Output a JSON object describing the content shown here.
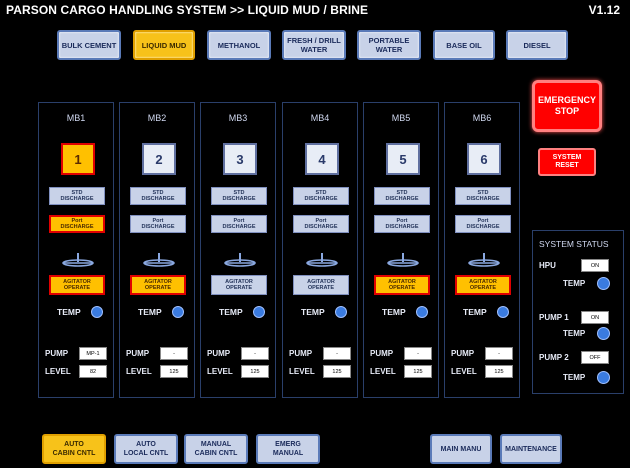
{
  "header": {
    "title": "PARSON CARGO HANDLING SYSTEM   >> LIQUID MUD / BRINE",
    "version": "V1.12"
  },
  "tabs": [
    {
      "label": "BULK CEMENT",
      "active": false
    },
    {
      "label": "LIQUID MUD",
      "active": true
    },
    {
      "label": "METHANOL",
      "active": false
    },
    {
      "label": "FRESH / DRILL\nWATER",
      "active": false
    },
    {
      "label": "PORTABLE\nWATER",
      "active": false
    },
    {
      "label": "BASE OIL",
      "active": false
    },
    {
      "label": "DIESEL",
      "active": false
    }
  ],
  "mixers": [
    {
      "name": "MB1",
      "number": "1",
      "selected": true,
      "std_discharge": "STD\nDISCHARGE",
      "std_active": false,
      "port_discharge": "Port\nDISCHARGE",
      "port_active": true,
      "agitator": "AGITATOR\nOPERATE",
      "agitator_active": true,
      "temp_label": "TEMP",
      "pump_label": "PUMP",
      "pump_value": "MP-1",
      "level_label": "LEVEL",
      "level_value": "82"
    },
    {
      "name": "MB2",
      "number": "2",
      "selected": false,
      "std_discharge": "STD\nDISCHARGE",
      "std_active": false,
      "port_discharge": "Port\nDISCHARGE",
      "port_active": false,
      "agitator": "AGITATOR\nOPERATE",
      "agitator_active": true,
      "temp_label": "TEMP",
      "pump_label": "PUMP",
      "pump_value": "-",
      "level_label": "LEVEL",
      "level_value": "125"
    },
    {
      "name": "MB3",
      "number": "3",
      "selected": false,
      "std_discharge": "STD\nDISCHARGE",
      "std_active": false,
      "port_discharge": "Port\nDISCHARGE",
      "port_active": false,
      "agitator": "AGITATOR\nOPERATE",
      "agitator_active": false,
      "temp_label": "TEMP",
      "pump_label": "PUMP",
      "pump_value": "-",
      "level_label": "LEVEL",
      "level_value": "125"
    },
    {
      "name": "MB4",
      "number": "4",
      "selected": false,
      "std_discharge": "STD\nDISCHARGE",
      "std_active": false,
      "port_discharge": "Port\nDISCHARGE",
      "port_active": false,
      "agitator": "AGITATOR\nOPERATE",
      "agitator_active": false,
      "temp_label": "TEMP",
      "pump_label": "PUMP",
      "pump_value": "-",
      "level_label": "LEVEL",
      "level_value": "125"
    },
    {
      "name": "MB5",
      "number": "5",
      "selected": false,
      "std_discharge": "STD\nDISCHARGE",
      "std_active": false,
      "port_discharge": "Port\nDISCHARGE",
      "port_active": false,
      "agitator": "AGITATOR\nOPERATE",
      "agitator_active": true,
      "temp_label": "TEMP",
      "pump_label": "PUMP",
      "pump_value": "-",
      "level_label": "LEVEL",
      "level_value": "125"
    },
    {
      "name": "MB6",
      "number": "6",
      "selected": false,
      "std_discharge": "STD\nDISCHARGE",
      "std_active": false,
      "port_discharge": "Port\nDISCHARGE",
      "port_active": false,
      "agitator": "AGITATOR\nOPERATE",
      "agitator_active": true,
      "temp_label": "TEMP",
      "pump_label": "PUMP",
      "pump_value": "-",
      "level_label": "LEVEL",
      "level_value": "125"
    }
  ],
  "emergency": {
    "stop_label": "EMERGENCY\nSTOP",
    "reset_label": "SYSTEM\nRESET"
  },
  "system_status": {
    "title": "SYSTEM STATUS",
    "hpu_label": "HPU",
    "hpu_value": "ON",
    "hpu_temp_label": "TEMP",
    "pump1_label": "PUMP 1",
    "pump1_value": "ON",
    "pump1_temp_label": "TEMP",
    "pump2_label": "PUMP 2",
    "pump2_value": "OFF",
    "pump2_temp_label": "TEMP"
  },
  "bottom_buttons": [
    {
      "label": "AUTO\nCABIN CNTL",
      "active": true
    },
    {
      "label": "AUTO\nLOCAL CNTL",
      "active": false
    },
    {
      "label": "MANUAL\nCABIN CNTL",
      "active": false
    },
    {
      "label": "EMERG\nMANUAL",
      "active": false
    },
    {
      "label": "MAIN MANU",
      "active": false
    },
    {
      "label": "MAINTENANCE",
      "active": false
    }
  ],
  "colors": {
    "background": "#000000",
    "button": "#c8d2e8",
    "active": "#f7c21a",
    "alarm": "#ff0000",
    "indicator": "#3a7be0"
  },
  "icons": {
    "temp_indicator": "blue-circle-indicator-icon",
    "agitator": "agitator-mixer-icon"
  }
}
